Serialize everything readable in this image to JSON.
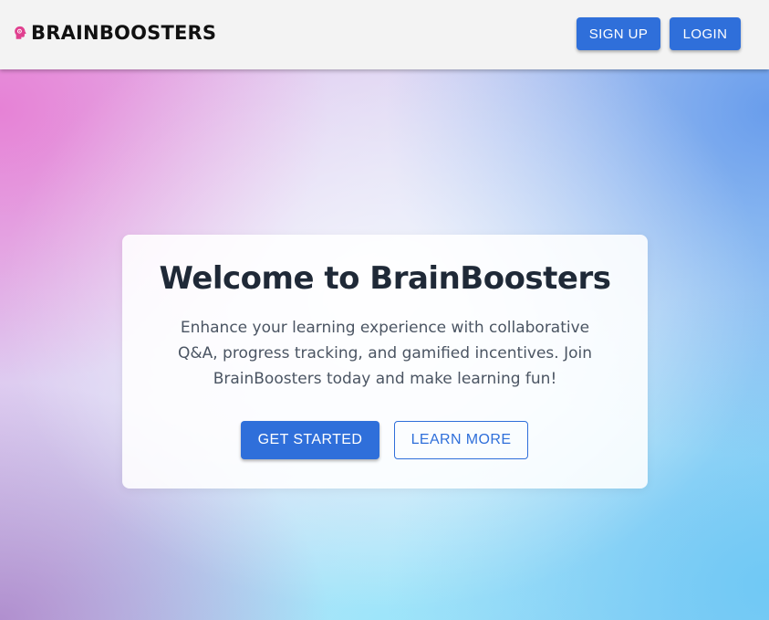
{
  "header": {
    "brand_name": "BRAINBOOSTERS",
    "brand_icon": "brain-head-icon",
    "signup_label": "SIGN UP",
    "login_label": "LOGIN"
  },
  "hero": {
    "title": "Welcome to BrainBoosters",
    "description": "Enhance your learning experience with collaborative Q&A, progress tracking, and gamified incentives. Join BrainBoosters today and make learning fun!",
    "get_started_label": "GET STARTED",
    "learn_more_label": "LEARN MORE"
  },
  "colors": {
    "primary": "#2f6fda",
    "brand_icon": "#e0408f",
    "title": "#1f2937",
    "text": "#4b5563",
    "header_bg": "#f3f3f3"
  }
}
